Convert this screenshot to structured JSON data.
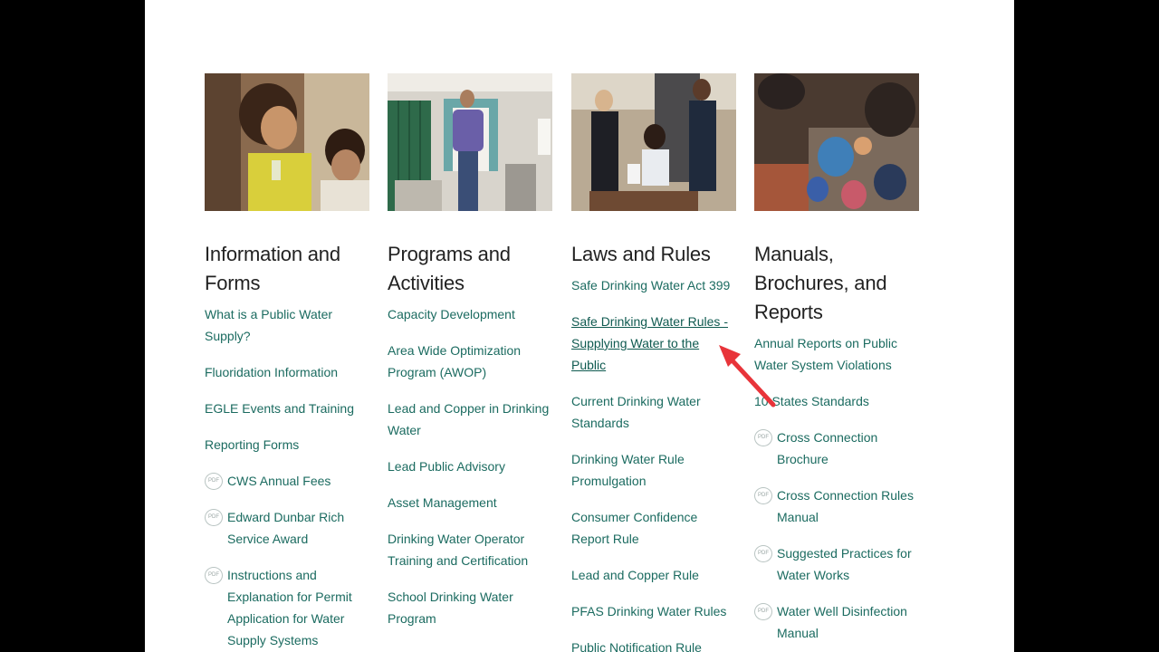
{
  "columns": [
    {
      "heading": "Information and Forms",
      "photo": "photo-family-child-drinking-water",
      "links": [
        {
          "label": "What is a Public Water Supply?",
          "pdf": false
        },
        {
          "label": "Fluoridation Information",
          "pdf": false
        },
        {
          "label": "EGLE Events and Training",
          "pdf": false
        },
        {
          "label": "Reporting Forms",
          "pdf": false
        },
        {
          "label": "CWS Annual Fees",
          "pdf": true
        },
        {
          "label": "Edward Dunbar Rich Service Award",
          "pdf": true
        },
        {
          "label": "Instructions and Explanation for Permit Application for Water Supply Systems",
          "pdf": true
        }
      ]
    },
    {
      "heading": "Programs and Activities",
      "photo": "photo-man-in-school-hallway",
      "links": [
        {
          "label": "Capacity Development",
          "pdf": false
        },
        {
          "label": "Area Wide Optimization Program (AWOP)",
          "pdf": false
        },
        {
          "label": "Lead and Copper in Drinking Water",
          "pdf": false
        },
        {
          "label": "Lead Public Advisory",
          "pdf": false
        },
        {
          "label": "Asset Management",
          "pdf": false
        },
        {
          "label": "Drinking Water Operator Training and Certification",
          "pdf": false
        },
        {
          "label": "School Drinking Water Program",
          "pdf": false
        }
      ]
    },
    {
      "heading": "Laws and Rules",
      "photo": "photo-bill-signing",
      "links": [
        {
          "label": "Safe Drinking Water Act 399",
          "pdf": false
        },
        {
          "label": "Safe Drinking Water Rules - Supplying Water to the Public",
          "pdf": false,
          "active": true
        },
        {
          "label": "Current Drinking Water Standards",
          "pdf": false
        },
        {
          "label": "Drinking Water Rule Promulgation",
          "pdf": false
        },
        {
          "label": "Consumer Confidence Report Rule",
          "pdf": false
        },
        {
          "label": "Lead and Copper Rule",
          "pdf": false
        },
        {
          "label": "PFAS Drinking Water Rules",
          "pdf": false
        },
        {
          "label": "Public Notification Rule",
          "pdf": false
        }
      ]
    },
    {
      "heading": "Manuals, Brochures, and Reports",
      "photo": "photo-crowd-at-event",
      "links": [
        {
          "label": "Annual Reports on Public Water System Violations",
          "pdf": false
        },
        {
          "label": "10 States Standards",
          "pdf": false
        },
        {
          "label": "Cross Connection Brochure",
          "pdf": true
        },
        {
          "label": "Cross Connection Rules Manual",
          "pdf": true
        },
        {
          "label": "Suggested Practices for Water Works",
          "pdf": true
        },
        {
          "label": "Water Well Disinfection Manual",
          "pdf": true
        }
      ]
    }
  ],
  "pdf_badge": "PDF",
  "annotation": {
    "arrow_color": "#e8343a"
  }
}
